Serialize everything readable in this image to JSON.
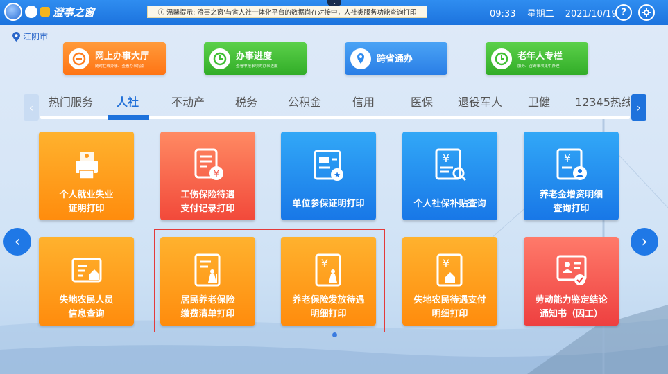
{
  "topbar": {
    "logo_text": "澄事之窗",
    "notice": "ⓘ 温馨提示: 澄事之窗'与省人社一体化平台的数据尚在对接中，人社类服务功能查询打印",
    "time": "09:33",
    "weekday": "星期二",
    "date": "2021/10/19",
    "help_icon": "question-icon",
    "settings_icon": "settings-icon"
  },
  "city": {
    "name": "江阴市",
    "icon": "location-pin-icon"
  },
  "quick_links": [
    {
      "title": "网上办事大厅",
      "subtitle": "随时在线办事、查看办事指南",
      "color": "#ff7d1f"
    },
    {
      "title": "办事进度",
      "subtitle": "查看申报事项的办事进度",
      "color": "#3fbf33"
    },
    {
      "title": "跨省通办",
      "subtitle": "",
      "color": "#2f8cf0"
    },
    {
      "title": "老年人专栏",
      "subtitle": "服务、咨询事项集中办理",
      "color": "#3fbf33"
    }
  ],
  "tabs": [
    "热门服务",
    "人社",
    "不动产",
    "税务",
    "公积金",
    "信用",
    "医保",
    "退役军人",
    "卫健",
    "12345热线"
  ],
  "active_tab": "人社",
  "tiles_row1": [
    {
      "line1": "个人就业失业",
      "line2": "证明打印",
      "icon": "printer-person-icon"
    },
    {
      "line1": "工伤保险待遇",
      "line2": "支付记录打印",
      "icon": "document-yen-icon"
    },
    {
      "line1": "单位参保证明打印",
      "line2": "",
      "icon": "briefcase-certificate-icon"
    },
    {
      "line1": "个人社保补贴查询",
      "line2": "",
      "icon": "yen-document-search-icon"
    },
    {
      "line1": "养老金增资明细",
      "line2": "查询打印",
      "icon": "yen-document-elder-icon"
    }
  ],
  "tiles_row2": [
    {
      "line1": "失地农民人员",
      "line2": "信息查询",
      "icon": "document-house-icon"
    },
    {
      "line1": "居民养老保险",
      "line2": "缴费清单打印",
      "icon": "document-elder-icon"
    },
    {
      "line1": "养老保险发放待遇",
      "line2": "明细打印",
      "icon": "yen-elder-icon"
    },
    {
      "line1": "失地农民待遇支付",
      "line2": "明细打印",
      "icon": "yen-house-icon"
    },
    {
      "line1": "劳动能力鉴定结论",
      "line2": "通知书（因工）",
      "icon": "certificate-person-icon"
    }
  ]
}
